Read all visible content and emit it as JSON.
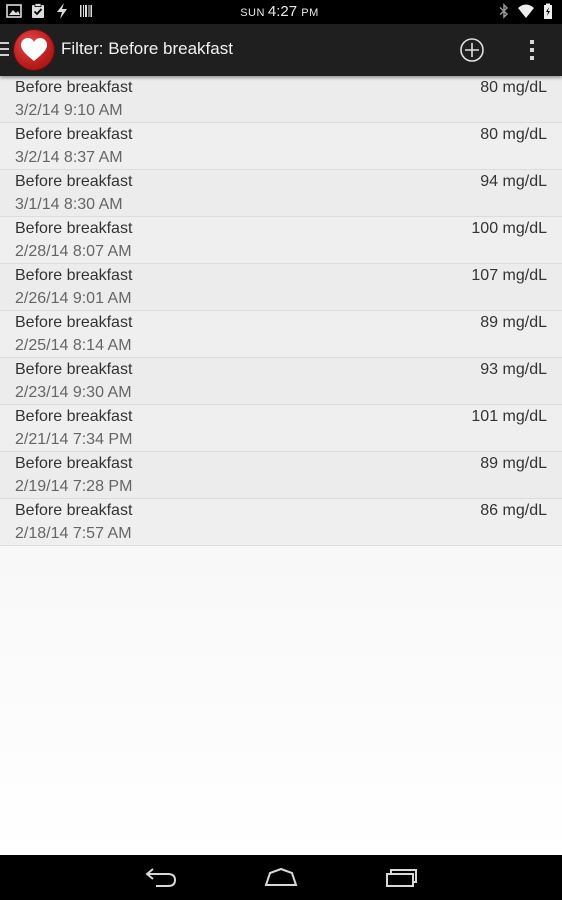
{
  "status_bar": {
    "day": "SUN",
    "time": "4:27",
    "ampm": "PM",
    "left_icons": [
      "image-icon",
      "clipboard-check-icon",
      "flash-icon",
      "barcode-icon"
    ],
    "right_icons": [
      "bluetooth-icon",
      "wifi-icon",
      "battery-charging-icon"
    ]
  },
  "action_bar": {
    "title": "Filter: Before breakfast",
    "app_icon": "heart-icon",
    "add_icon": "add-circle-icon",
    "overflow_icon": "overflow-menu-icon",
    "brand_color": "#b71c1c"
  },
  "entries": [
    {
      "label": "Before breakfast",
      "value": "80 mg/dL",
      "time": "3/2/14 9:10 AM"
    },
    {
      "label": "Before breakfast",
      "value": "80 mg/dL",
      "time": "3/2/14 8:37 AM"
    },
    {
      "label": "Before breakfast",
      "value": "94 mg/dL",
      "time": "3/1/14 8:30 AM"
    },
    {
      "label": "Before breakfast",
      "value": "100 mg/dL",
      "time": "2/28/14 8:07 AM"
    },
    {
      "label": "Before breakfast",
      "value": "107 mg/dL",
      "time": "2/26/14 9:01 AM"
    },
    {
      "label": "Before breakfast",
      "value": "89 mg/dL",
      "time": "2/25/14 8:14 AM"
    },
    {
      "label": "Before breakfast",
      "value": "93 mg/dL",
      "time": "2/23/14 9:30 AM"
    },
    {
      "label": "Before breakfast",
      "value": "101 mg/dL",
      "time": "2/21/14 7:34 PM"
    },
    {
      "label": "Before breakfast",
      "value": "89 mg/dL",
      "time": "2/19/14 7:28 PM"
    },
    {
      "label": "Before breakfast",
      "value": "86 mg/dL",
      "time": "2/18/14 7:57 AM"
    }
  ],
  "nav_bar": {
    "back_icon": "back-icon",
    "home_icon": "home-icon",
    "recents_icon": "recent-apps-icon"
  }
}
